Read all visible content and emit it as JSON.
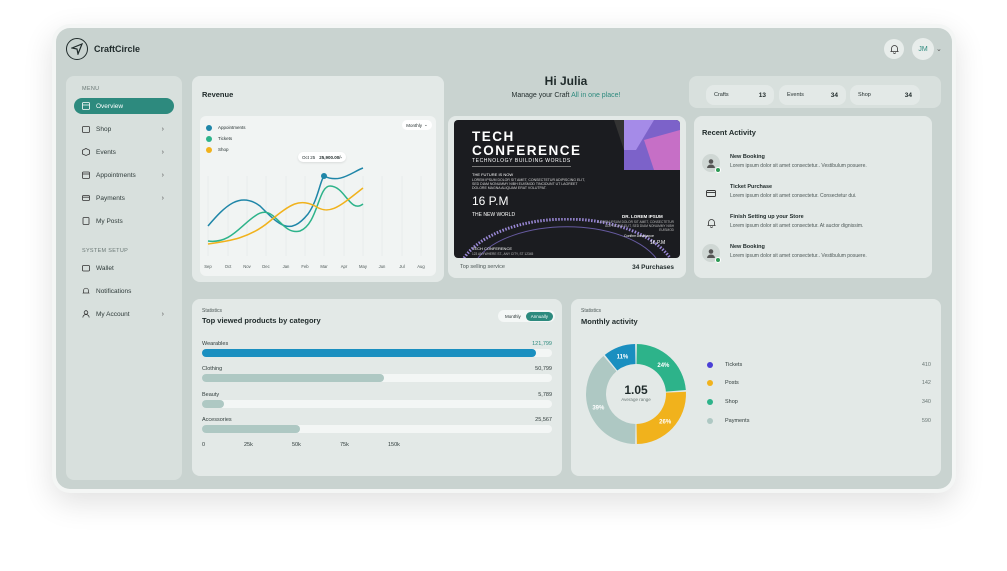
{
  "brand": {
    "name": "CraftCircle"
  },
  "header": {
    "avatar_initials": "JM",
    "greeting": "Hi Julia",
    "sub_prefix": "Manage your Craft",
    "sub_highlight": "All in one place!"
  },
  "sidebar": {
    "menu_label": "MENU",
    "items": [
      {
        "label": "Overview"
      },
      {
        "label": "Shop"
      },
      {
        "label": "Events"
      },
      {
        "label": "Appointments"
      },
      {
        "label": "Payments"
      },
      {
        "label": "My Posts"
      }
    ],
    "system_label": "SYSTEM SETUP",
    "system_items": [
      {
        "label": "Wallet"
      },
      {
        "label": "Notifications"
      },
      {
        "label": "My Account"
      }
    ]
  },
  "stats": [
    {
      "label": "Crafts",
      "value": "13"
    },
    {
      "label": "Events",
      "value": "34"
    },
    {
      "label": "Shop",
      "value": "34"
    }
  ],
  "revenue": {
    "title": "Revenue",
    "period": "Monthly",
    "tooltip_date": "Oct 25",
    "tooltip_value": "25,900.00/-",
    "legend": [
      {
        "name": "Appointments",
        "color": "#1f86a8"
      },
      {
        "name": "Tickets",
        "color": "#2db38a"
      },
      {
        "name": "Shop",
        "color": "#f1b21c"
      }
    ],
    "months": [
      "Sep",
      "Oct",
      "Nov",
      "Dec",
      "Jan",
      "Feb",
      "Mar",
      "Apr",
      "May",
      "Jun",
      "Jul",
      "Aug"
    ]
  },
  "event": {
    "poster_title_1": "TECH",
    "poster_title_2": "CONFERENCE",
    "poster_subtitle": "TECHNOLOGY BUILDING WORLDS",
    "poster_future": "THE FUTURE IS NOW",
    "poster_lorem": [
      "LOREM IPSUM DOLOR SIT AMET, CONSECTETUR ADIPISCING ELIT,",
      "SED DIAM NONUMMY NIBH EUISMOD TINCIDUNT UT LAOREET",
      "DOLORE MAGNA ALIQUAM ERAT VOLUTPAT."
    ],
    "poster_time": "16 P.M",
    "poster_world": "THE NEW WORLD",
    "poster_speaker": "DR. LOREM IPSUM",
    "poster_speaker_desc": "LOREM IPSUM DOLOR SIT AMET, CONSECTETUR ADIPISCING ELIT, SED DIAM NONUMMY NIBH EUISMOD",
    "poster_confirm": "Confirm Assistance",
    "poster_pm": "16 P.M",
    "poster_tc": "TECH CONFERENCE",
    "poster_address": "123 ANYWHERE ST., ANY CITY, ST 12345",
    "foot_label": "Top selling service",
    "foot_value": "34 Purchases"
  },
  "activity": {
    "title": "Recent Activity",
    "items": [
      {
        "title": "New Booking",
        "desc": "Lorem ipsum dolor sit amet consectetur.. Vestibulum posuere."
      },
      {
        "title": "Ticket Purchase",
        "desc": "Lorem ipsum dolor sit amet consectetur. Consectetur dui."
      },
      {
        "title": "Finish Setting up your Store",
        "desc": "Lorem ipsum dolor sit amet consectetur. At auctor dignissim."
      },
      {
        "title": "New Booking",
        "desc": "Lorem ipsum dolor sit amet consectetur.. Vestibulum posuere."
      }
    ]
  },
  "top_viewed": {
    "overline": "Statistics",
    "title": "Top viewed products by category",
    "toggle": [
      "Monthly",
      "Annually"
    ],
    "rows": [
      {
        "label": "Wearables",
        "value": "121,799",
        "fraction": 0.953,
        "color": "#1a8fc0"
      },
      {
        "label": "Clothing",
        "value": "50,799",
        "fraction": 0.52,
        "color": "#aec8c3"
      },
      {
        "label": "Beauty",
        "value": "5,789",
        "fraction": 0.063,
        "color": "#aec8c3"
      },
      {
        "label": "Accessories",
        "value": "25,567",
        "fraction": 0.28,
        "color": "#aec8c3"
      }
    ],
    "axis": [
      "0",
      "25k",
      "50k",
      "75k",
      "150k"
    ]
  },
  "monthly_activity": {
    "overline": "Statistics",
    "title": "Monthly activity",
    "center_value": "1.05",
    "center_label": "Average range",
    "chart_data": {
      "type": "pie",
      "slices": [
        {
          "label": "11%",
          "value": 11,
          "color": "#1a8fc0"
        },
        {
          "label": "24%",
          "value": 24,
          "color": "#2db38a"
        },
        {
          "label": "26%",
          "value": 26,
          "color": "#f1b21c"
        },
        {
          "label": "39%",
          "value": 39,
          "color": "#aec8c3"
        }
      ]
    },
    "legend": [
      {
        "name": "Tickets",
        "value": "410",
        "color": "#4a3fd6"
      },
      {
        "name": "Posts",
        "value": "142",
        "color": "#f1b21c"
      },
      {
        "name": "Shop",
        "value": "340",
        "color": "#2db38a"
      },
      {
        "name": "Payments",
        "value": "590",
        "color": "#aec8c3"
      }
    ]
  }
}
